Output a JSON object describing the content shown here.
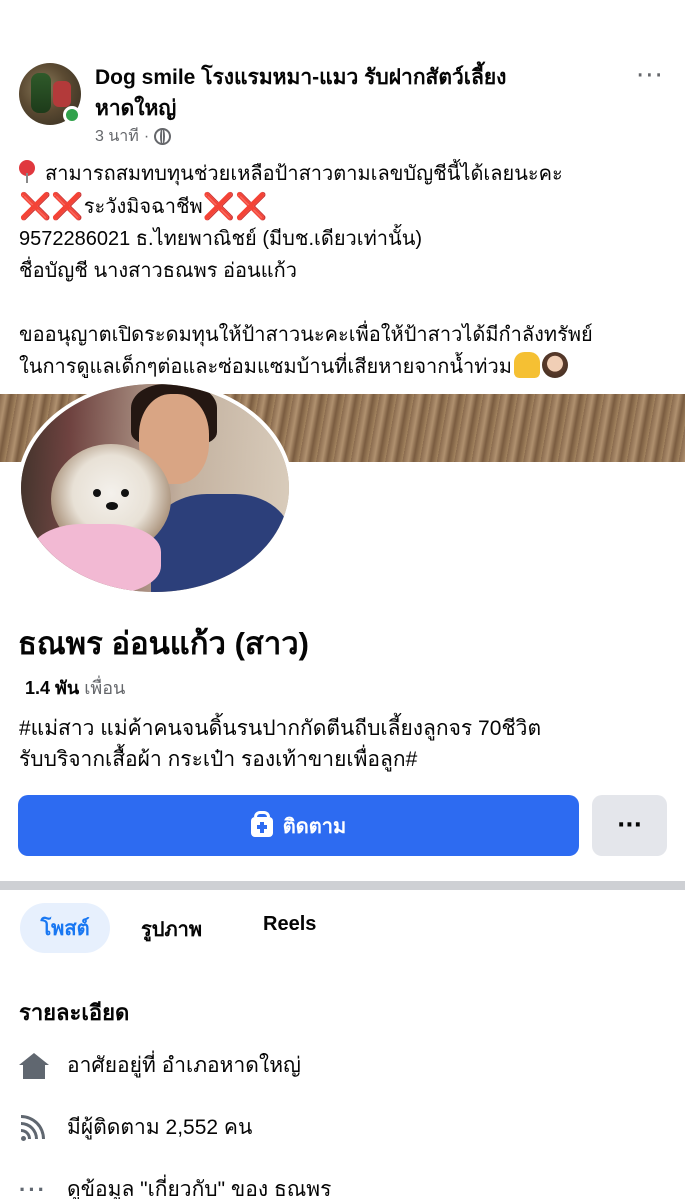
{
  "post": {
    "page_name_line1": "Dog smile โรงแรมหมา-แมว รับฝากสัตว์เลี้ยง",
    "page_name_line2": "หาดใหญ่",
    "time": "3 นาที",
    "separator": "·",
    "more": "···",
    "lines": {
      "l1": "สามารถสมทบทุนช่วยเหลือป้าสาวตามเลขบัญชีนี้ได้เลยนะคะ",
      "l2_x": "❌❌",
      "l2_text": "ระวังมิจฉาชีพ",
      "l2_x2": "❌❌",
      "l3": "9572286021 ธ.ไทยพาณิชย์ (มีบช.เดียวเท่านั้น)",
      "l4": "ชื่อบัญชี นางสาวธณพร อ่อนแก้ว",
      "l5": "ขออนุญาตเปิดระดมทุนให้ป้าสาวนะคะเพื่อให้ป้าสาวได้มีกำลังทรัพย์",
      "l6": "ในการดูแลเด็กๆต่อและซ่อมแซมบ้านที่เสียหายจากน้ำท่วม"
    }
  },
  "profile": {
    "name": "ธณพร อ่อนแก้ว (สาว)",
    "friends_count": "1.4 พัน",
    "friends_label": "เพื่อน",
    "bio_line1": "#แม่สาว แม่ค้าคนจนดิ้นรนปากกัดตีนถีบเลี้ยงลูกจร 70ชีวิต",
    "bio_line2": "รับบริจากเสื้อผ้า กระเป๋า รองเท้าขายเพื่อลูก#",
    "follow_label": "ติดตาม",
    "more_label": "···"
  },
  "tabs": {
    "posts": "โพสต์",
    "photos": "รูปภาพ",
    "reels": "Reels"
  },
  "details": {
    "title": "รายละเอียด",
    "lives_in": "อาศัยอยู่ที่ อำเภอหาดใหญ่",
    "followers": "มีผู้ติดตาม 2,552 คน",
    "about": "ดูข้อมูล \"เกี่ยวกับ\" ของ ธณพร"
  },
  "colors": {
    "accent": "#2d6bf1",
    "tab_active_bg": "#e7f0fd",
    "tab_active_text": "#1877f2",
    "online": "#31a24c"
  }
}
